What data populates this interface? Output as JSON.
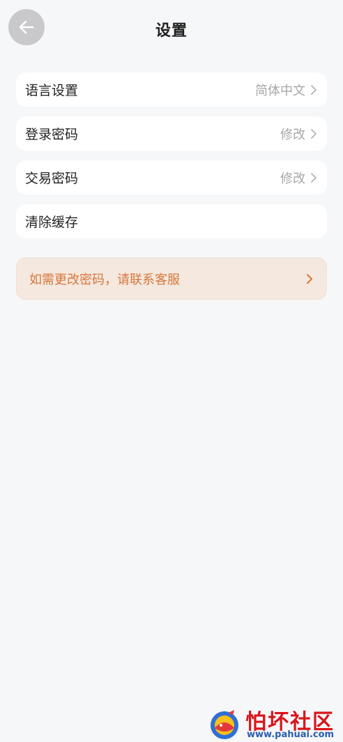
{
  "header": {
    "title": "设置",
    "back_icon": "arrow-left-icon"
  },
  "settings": {
    "items": [
      {
        "label": "语言设置",
        "value": "简体中文",
        "icon": "chevron-right-icon"
      },
      {
        "label": "登录密码",
        "value": "修改",
        "icon": "chevron-right-icon"
      },
      {
        "label": "交易密码",
        "value": "修改",
        "icon": "chevron-right-icon"
      },
      {
        "label": "清除缓存",
        "value": ""
      }
    ]
  },
  "notice": {
    "text": "如需更改密码，请联系客服",
    "icon": "chevron-right-icon",
    "color": "#d9763a",
    "background": "#f4e8df"
  },
  "watermark": {
    "title": "怕坏社区",
    "url": "www.pahuai.com"
  },
  "colors": {
    "page_background": "#f6f7f9",
    "back_button": "#c9c9cb",
    "muted_text": "#a7a7a7"
  }
}
